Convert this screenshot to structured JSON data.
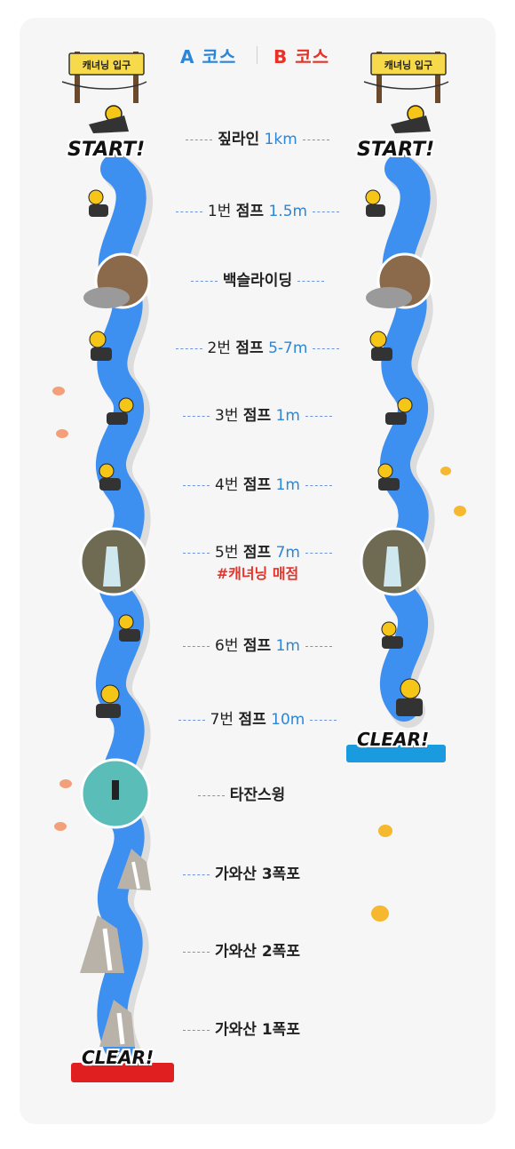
{
  "courses": {
    "a": "A 코스",
    "b": "B 코스"
  },
  "sign": {
    "label": "캐녀닝 입구"
  },
  "labels": {
    "start": "START!",
    "clear": "CLEAR!"
  },
  "steps": [
    {
      "num": "",
      "act": "짚라인",
      "val": "1km",
      "note": ""
    },
    {
      "num": "1번",
      "act": "점프",
      "val": "1.5m",
      "note": ""
    },
    {
      "num": "",
      "act": "백슬라이딩",
      "val": "",
      "note": ""
    },
    {
      "num": "2번",
      "act": "점프",
      "val": "5-7m",
      "note": ""
    },
    {
      "num": "3번",
      "act": "점프",
      "val": "1m",
      "note": ""
    },
    {
      "num": "4번",
      "act": "점프",
      "val": "1m",
      "note": ""
    },
    {
      "num": "5번",
      "act": "점프",
      "val": "7m",
      "note": "#캐녀닝 매점"
    },
    {
      "num": "6번",
      "act": "점프",
      "val": "1m",
      "note": ""
    },
    {
      "num": "7번",
      "act": "점프",
      "val": "10m",
      "note": ""
    },
    {
      "num": "",
      "act": "타잔스윙",
      "val": "",
      "note": ""
    },
    {
      "num": "",
      "act": "가와산 3폭포",
      "val": "",
      "note": ""
    },
    {
      "num": "",
      "act": "가와산 2폭포",
      "val": "",
      "note": ""
    },
    {
      "num": "",
      "act": "가와산 1폭포",
      "val": "",
      "note": ""
    }
  ],
  "colors": {
    "accent": "#2c86d8",
    "highlight": "#e6332a",
    "river": "#3d8ff0",
    "banner": "#1a9be0",
    "bannerRed": "#e02020"
  },
  "icons": [
    "zipline-icon",
    "jumper-icon",
    "photo-icon",
    "fish-icon",
    "waterfall-icon"
  ]
}
